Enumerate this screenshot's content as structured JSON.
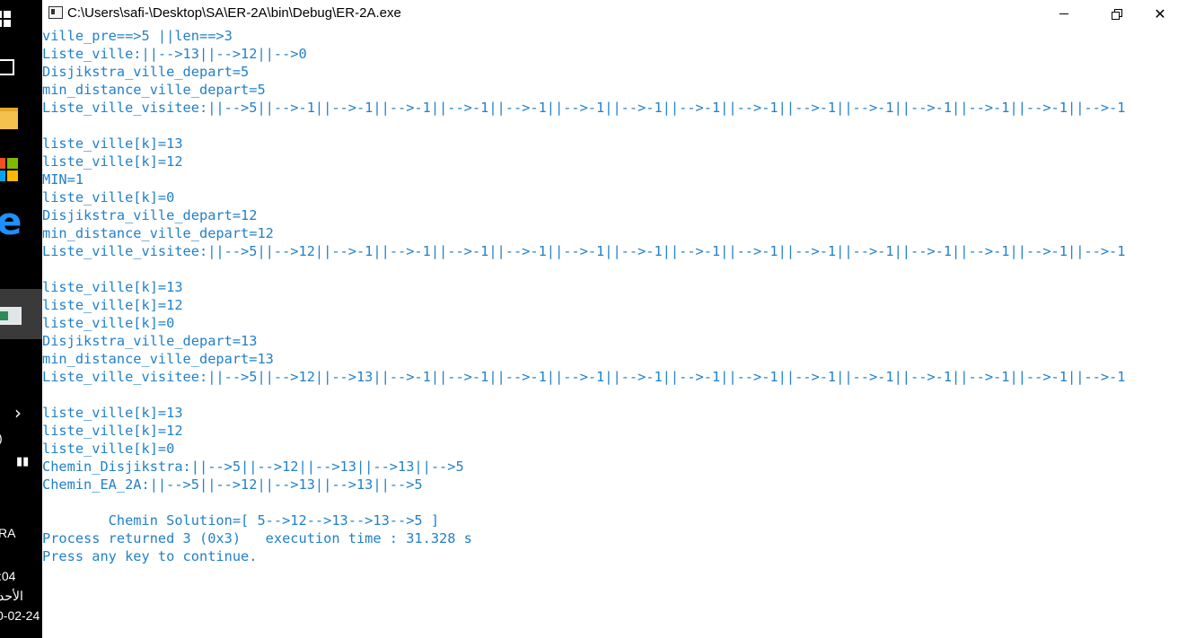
{
  "window": {
    "title": "C:\\Users\\safi-\\Desktop\\SA\\ER-2A\\bin\\Debug\\ER-2A.exe",
    "minimize_glyph": "—",
    "maximize_glyph": "❐",
    "close_glyph": "✕"
  },
  "taskbar": {
    "icons": [
      "windows-start-icon",
      "task-view-icon",
      "file-explorer-icon",
      "store-icon",
      "edge-icon",
      "console-app-icon",
      "chevron-right-icon"
    ],
    "tray_text_1": ")",
    "lang": "RA",
    "time": ":04",
    "day": "الأحد",
    "date": "0-02-24"
  },
  "console": {
    "text_color": "#2380c8",
    "lines": [
      "ville_pre==>5 ||len==>3",
      "Liste_ville:||-->13||-->12||-->0",
      "Disjikstra_ville_depart=5",
      "min_distance_ville_depart=5",
      "Liste_ville_visitee:||-->5||-->-1||-->-1||-->-1||-->-1||-->-1||-->-1||-->-1||-->-1||-->-1||-->-1||-->-1||-->-1||-->-1||-->-1||-->-1",
      "",
      "liste_ville[k]=13",
      "liste_ville[k]=12",
      "MIN=1",
      "liste_ville[k]=0",
      "Disjikstra_ville_depart=12",
      "min_distance_ville_depart=12",
      "Liste_ville_visitee:||-->5||-->12||-->-1||-->-1||-->-1||-->-1||-->-1||-->-1||-->-1||-->-1||-->-1||-->-1||-->-1||-->-1||-->-1||-->-1",
      "",
      "liste_ville[k]=13",
      "liste_ville[k]=12",
      "liste_ville[k]=0",
      "Disjikstra_ville_depart=13",
      "min_distance_ville_depart=13",
      "Liste_ville_visitee:||-->5||-->12||-->13||-->-1||-->-1||-->-1||-->-1||-->-1||-->-1||-->-1||-->-1||-->-1||-->-1||-->-1||-->-1||-->-1",
      "",
      "liste_ville[k]=13",
      "liste_ville[k]=12",
      "liste_ville[k]=0",
      "Chemin_Disjikstra:||-->5||-->12||-->13||-->13||-->5",
      "Chemin_EA_2A:||-->5||-->12||-->13||-->13||-->5",
      "",
      "        Chemin Solution=[ 5-->12-->13-->13-->5 ]",
      "Process returned 3 (0x3)   execution time : 31.328 s",
      "Press any key to continue."
    ]
  }
}
